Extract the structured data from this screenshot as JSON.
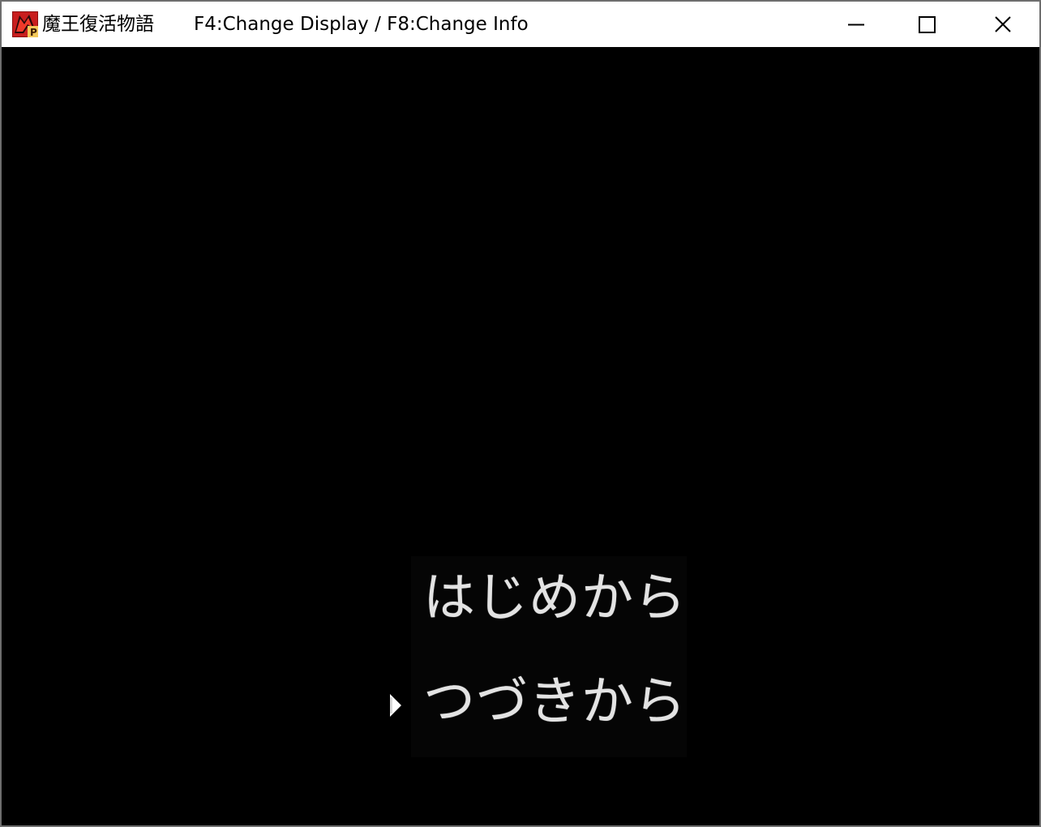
{
  "window": {
    "title": "魔王復活物語",
    "hint": "F4:Change Display / F8:Change Info",
    "icon": "rpg-maker-app-icon",
    "controls": {
      "minimize": "minimize-icon",
      "maximize": "maximize-icon",
      "close": "close-icon"
    }
  },
  "game": {
    "background_color": "#000000",
    "menu": {
      "items": [
        {
          "label": "はじめから"
        },
        {
          "label": "つづきから"
        }
      ],
      "selected_index": 1,
      "cursor_icon": "right-triangle-cursor-icon"
    }
  }
}
